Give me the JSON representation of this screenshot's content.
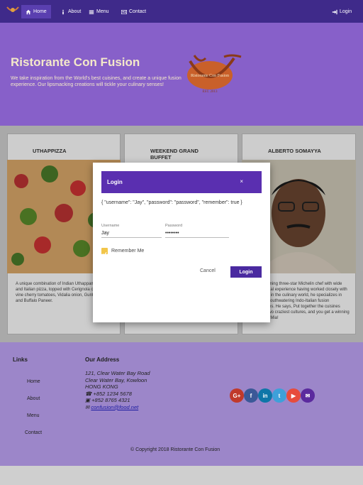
{
  "nav": {
    "home": "Home",
    "about": "About",
    "menu": "Menu",
    "contact": "Contact",
    "login": "Login"
  },
  "jumbotron": {
    "title": "Ristorante Con Fusion",
    "description": "We take inspiration from the World's best cuisines, and create a unique fusion experience. Our lipsmacking creations will tickle your culinary senses!",
    "logo_text": "Ristorante Con Fusion",
    "logo_year": "EST. 2013"
  },
  "cards": [
    {
      "title": "UTHAPPIZZA",
      "text": "A unique combination of Indian Uthappam (pancake) and Italian pizza, topped with Cerignola olives, ripe vine cherry tomatoes, Vidalia onion, Guntur chillies and Buffalo Paneer."
    },
    {
      "title": "WEEKEND GRAND BUFFET",
      "text": ""
    },
    {
      "title": "ALBERTO SOMAYYA",
      "text": "Award winning three-star Michelin chef with wide International experience having worked closely with whos-who in the culinary world, he specializes in creating mouthwatering Indo-Italian fusion experiences. He says, Put together the cuisines from the two craziest cultures, and you get a winning hit! Amma Mia!"
    }
  ],
  "modal": {
    "title": "Login",
    "close": "×",
    "json_state": "{ \"username\": \"Jay\", \"password\": \"password\", \"remember\": true }",
    "username_label": "Username",
    "username_value": "Jay",
    "password_label": "Password",
    "password_value": "••••••••",
    "remember_label": "Remember Me",
    "remember_checked": true,
    "cancel": "Cancel",
    "submit": "Login"
  },
  "footer": {
    "links_title": "Links",
    "links": [
      "Home",
      "About",
      "Menu",
      "Contact"
    ],
    "address_title": "Our Address",
    "address_lines": [
      "121, Clear Water Bay Road",
      "Clear Water Bay, Kowloon",
      "HONG KONG"
    ],
    "phone": "+852 1234 5678",
    "fax": "+852 8765 4321",
    "email": "confusion@food.net",
    "copyright": "© Copyright 2018 Ristorante Con Fusion",
    "social": [
      {
        "icon": "google-plus-icon",
        "glyph": "G+",
        "color": "#c0392b"
      },
      {
        "icon": "facebook-icon",
        "glyph": "f",
        "color": "#3b5998"
      },
      {
        "icon": "linkedin-icon",
        "glyph": "in",
        "color": "#0e76a8"
      },
      {
        "icon": "twitter-icon",
        "glyph": "t",
        "color": "#3ea0d9"
      },
      {
        "icon": "youtube-icon",
        "glyph": "▶",
        "color": "#e74c3c"
      },
      {
        "icon": "mail-icon",
        "glyph": "✉",
        "color": "#5b2a9e"
      }
    ]
  },
  "colors": {
    "navbar": "#3f2a8a",
    "jumbotron": "#8760c9",
    "accent": "#5a2fb0",
    "footer": "#9c86c9"
  }
}
